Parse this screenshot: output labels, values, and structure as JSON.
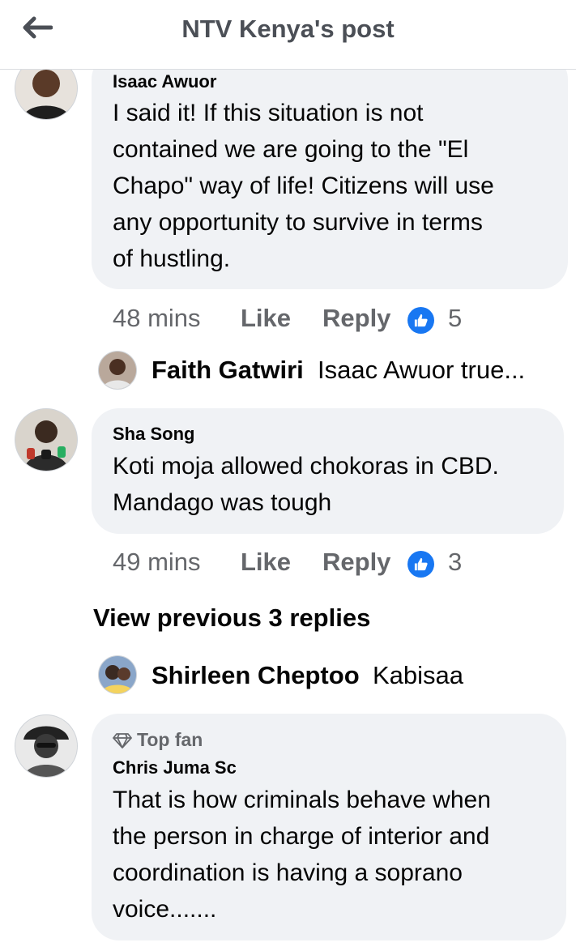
{
  "header": {
    "title": "NTV Kenya's post"
  },
  "comments": [
    {
      "author": "Isaac Awuor",
      "lines": [
        "I said it! If this situation is not",
        "contained we are going to the \"El",
        "Chapo\" way of life!  Citizens will use",
        "any opportunity to survive in terms",
        "of hustling."
      ],
      "time": "48 mins",
      "like": "Like",
      "reply": "Reply",
      "reactions": "5"
    },
    {
      "author": "Sha Song",
      "lines": [
        "Koti moja allowed chokoras in CBD.",
        "Mandago was tough"
      ],
      "time": "49 mins",
      "like": "Like",
      "reply": "Reply",
      "reactions": "3"
    },
    {
      "badge": "Top fan",
      "author": "Chris Juma Sc",
      "lines": [
        "That is how criminals behave when",
        "the person in charge of  interior and",
        "coordination is having a soprano",
        "voice......."
      ]
    }
  ],
  "replies": [
    {
      "name": "Faith Gatwiri",
      "text": "Isaac Awuor true..."
    },
    {
      "name": "Shirleen Cheptoo",
      "text": "Kabisaa"
    }
  ],
  "view_previous": "View previous 3 replies",
  "colors": {
    "accent": "#1877f2",
    "bubble": "#f0f2f5",
    "meta": "#65676b"
  }
}
